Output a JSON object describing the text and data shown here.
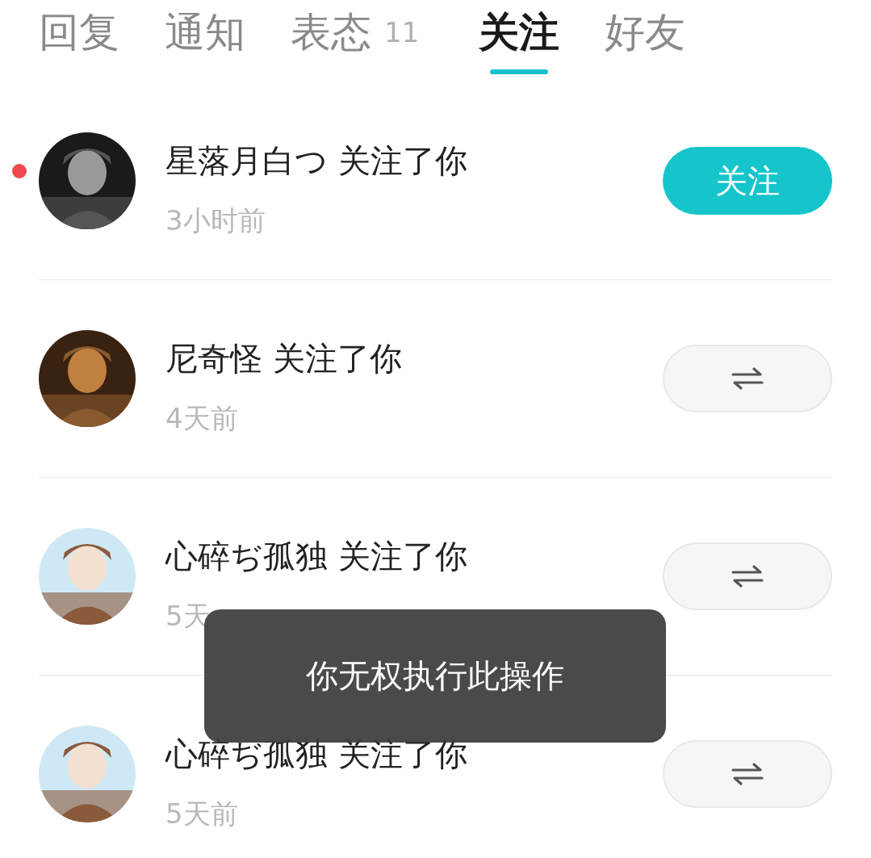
{
  "tabs": [
    {
      "label": "回复",
      "selected": false
    },
    {
      "label": "通知",
      "selected": false
    },
    {
      "label": "表态",
      "badge": "11",
      "selected": false
    },
    {
      "label": "关注",
      "selected": true
    },
    {
      "label": "好友",
      "selected": false
    }
  ],
  "items": [
    {
      "text": "星落月白つ 关注了你",
      "time": "3小时前",
      "unread": true,
      "button": {
        "kind": "follow",
        "label": "关注"
      }
    },
    {
      "text": "尼奇怪 关注了你",
      "time": "4天前",
      "unread": false,
      "button": {
        "kind": "mutual"
      }
    },
    {
      "text": "心碎ぢ孤独 关注了你",
      "time": "5天",
      "unread": false,
      "button": {
        "kind": "mutual"
      }
    },
    {
      "text": "心碎ぢ孤独 关注了你",
      "time": "5天前",
      "unread": false,
      "button": {
        "kind": "mutual"
      }
    }
  ],
  "toast": {
    "text": "你无权执行此操作"
  }
}
